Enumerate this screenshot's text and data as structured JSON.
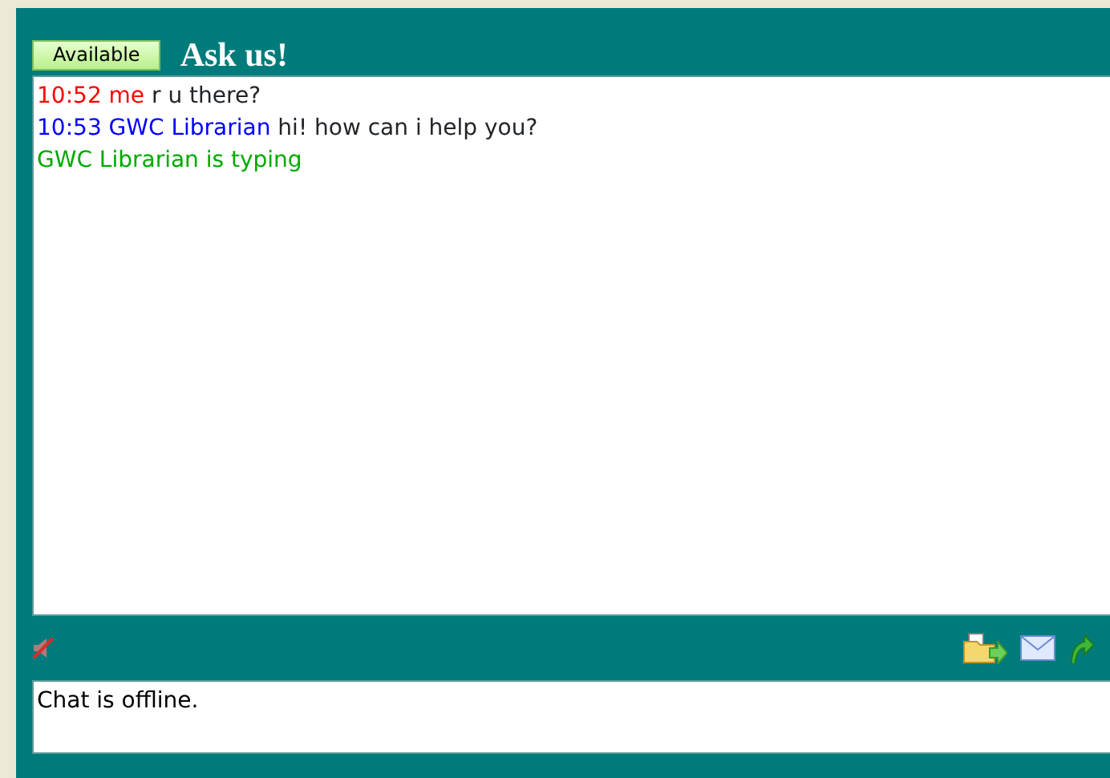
{
  "status_button": {
    "label": "Available"
  },
  "title": "Ask us!",
  "messages": [
    {
      "kind": "message",
      "time": "10:52",
      "sender": "me",
      "text": "r u there?",
      "color": "#ff0000"
    },
    {
      "kind": "message",
      "time": "10:53",
      "sender": "GWC Librarian",
      "text": "hi! how can i help you?",
      "color": "#0000ff"
    },
    {
      "kind": "status",
      "text": "GWC Librarian is typing",
      "color": "#00aa00"
    }
  ],
  "sound": {
    "muted": true
  },
  "input": {
    "value": "Chat is offline."
  }
}
